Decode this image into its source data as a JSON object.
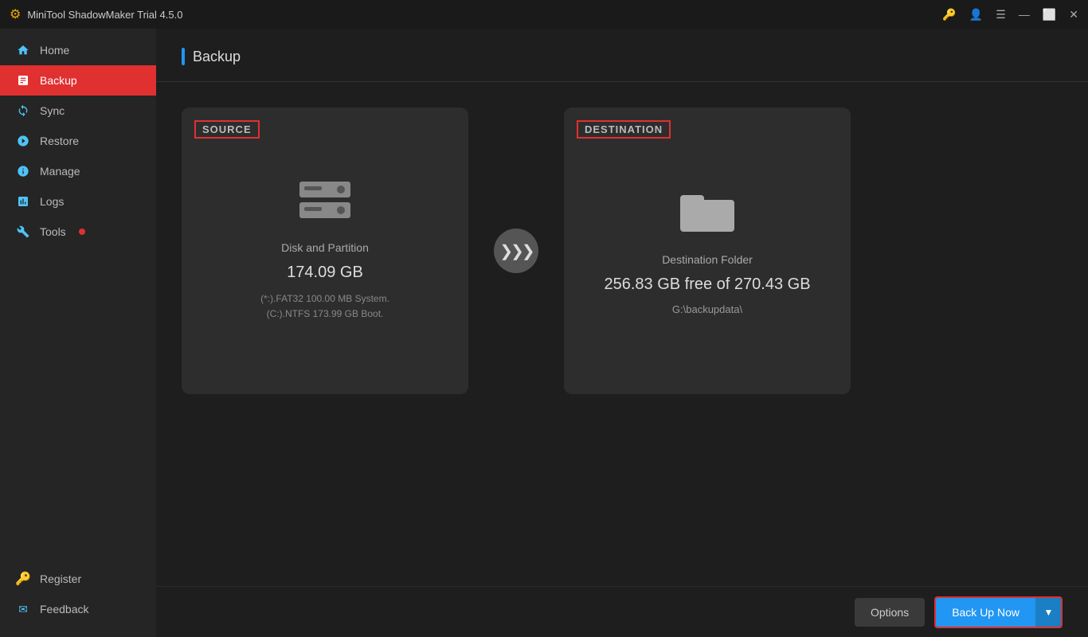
{
  "titlebar": {
    "title": "MiniTool ShadowMaker Trial 4.5.0",
    "icon": "🛡"
  },
  "sidebar": {
    "nav_items": [
      {
        "id": "home",
        "label": "Home",
        "icon": "house"
      },
      {
        "id": "backup",
        "label": "Backup",
        "icon": "backup",
        "active": true
      },
      {
        "id": "sync",
        "label": "Sync",
        "icon": "sync"
      },
      {
        "id": "restore",
        "label": "Restore",
        "icon": "restore"
      },
      {
        "id": "manage",
        "label": "Manage",
        "icon": "manage"
      },
      {
        "id": "logs",
        "label": "Logs",
        "icon": "logs"
      },
      {
        "id": "tools",
        "label": "Tools",
        "icon": "tools",
        "has_dot": true
      }
    ],
    "bottom_items": [
      {
        "id": "register",
        "label": "Register",
        "icon": "key"
      },
      {
        "id": "feedback",
        "label": "Feedback",
        "icon": "mail"
      }
    ]
  },
  "page": {
    "title": "Backup"
  },
  "source_card": {
    "header": "SOURCE",
    "icon_type": "disk",
    "main_text": "Disk and Partition",
    "size_text": "174.09 GB",
    "detail_line1": "(*:).FAT32 100.00 MB System.",
    "detail_line2": "(C:).NTFS 173.99 GB Boot."
  },
  "destination_card": {
    "header": "DESTINATION",
    "icon_type": "folder",
    "main_text": "Destination Folder",
    "size_text": "256.83 GB free of 270.43 GB",
    "path_text": "G:\\backupdata\\"
  },
  "arrow": {
    "symbol": "»»"
  },
  "bottom_bar": {
    "options_label": "Options",
    "backup_now_label": "Back Up Now",
    "dropdown_symbol": "▼"
  }
}
